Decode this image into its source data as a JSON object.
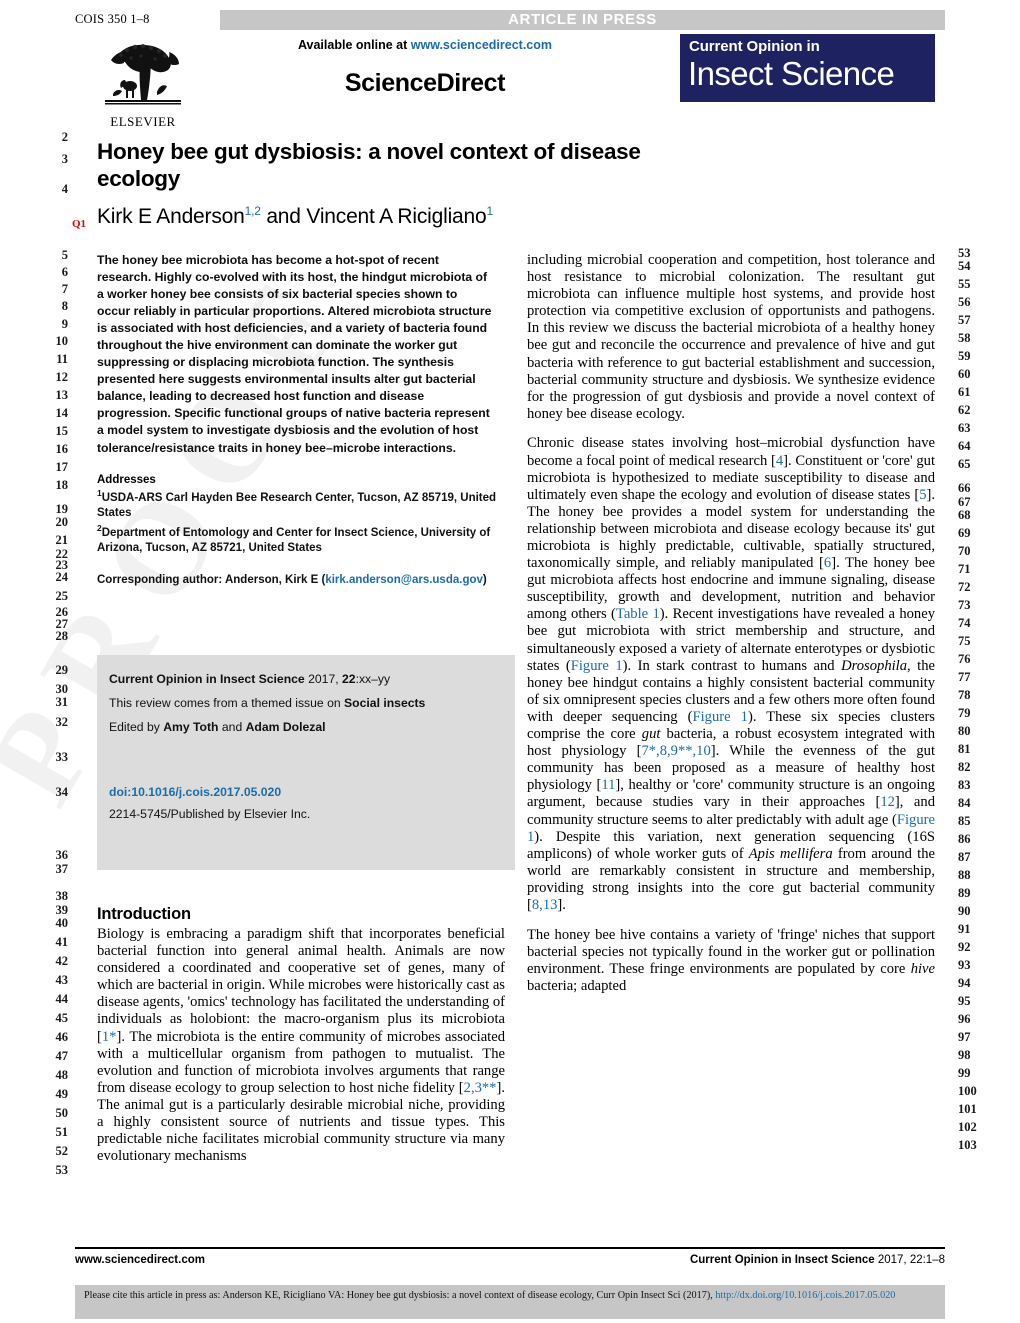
{
  "header": {
    "article_id": "COIS 350 1–8",
    "status_banner": "ARTICLE IN PRESS",
    "available_online": "Available online at",
    "sciencedirect_url": "www.sciencedirect.com",
    "sciencedirect_name": "ScienceDirect",
    "publisher_logo_text": "ELSEVIER",
    "journal_logo_line1": "Current Opinion in",
    "journal_logo_line2": "Insect Science",
    "colors": {
      "banner_gray": "#c6c6c6",
      "journal_navy": "#1f2260",
      "link_blue": "#1b6ca8",
      "query_red": "#e00000",
      "infobox_gray": "#dcdcdc"
    }
  },
  "article": {
    "title": "Honey bee gut dysbiosis: a novel context of disease ecology",
    "authors": "Kirk E Anderson and Vincent A Ricigliano",
    "author1_name": "Kirk E Anderson",
    "author1_sup": "1,2",
    "author2_name": "Vincent A Ricigliano",
    "author2_sup": "1",
    "query_marker": "Q1"
  },
  "abstract": {
    "text": "The honey bee microbiota has become a hot-spot of recent research. Highly co-evolved with its host, the hindgut microbiota of a worker honey bee consists of six bacterial species shown to occur reliably in particular proportions. Altered microbiota structure is associated with host deficiencies, and a variety of bacteria found throughout the hive environment can dominate the worker gut suppressing or displacing microbiota function. The synthesis presented here suggests environmental insults alter gut bacterial balance, leading to decreased host function and disease progression. Specific functional groups of native bacteria represent a model system to investigate dysbiosis and the evolution of host tolerance/resistance traits in honey bee–microbe interactions."
  },
  "addresses": {
    "heading": "Addresses",
    "items": [
      {
        "sup": "1",
        "text": "USDA-ARS Carl Hayden Bee Research Center, Tucson, AZ 85719, United States"
      },
      {
        "sup": "2",
        "text": "Department of Entomology and Center for Insect Science, University of Arizona, Tucson, AZ 85721, United States"
      }
    ],
    "corresponding_label": "Corresponding author: Anderson, Kirk E (",
    "corresponding_email": "kirk.anderson@ars.usda.gov",
    "corresponding_close": ")"
  },
  "infobox": {
    "journal_ref_bold": "Current Opinion in Insect Science",
    "journal_ref_rest": " 2017, ",
    "journal_volume": "22",
    "journal_pages": ":xx–yy",
    "themed_issue_pre": "This review comes from a themed issue on ",
    "themed_issue_topic": "Social insects",
    "edited_by_pre": "Edited by ",
    "editor1": "Amy Toth",
    "edited_by_mid": " and ",
    "editor2": "Adam Dolezal",
    "doi": "doi:10.1016/j.cois.2017.05.020",
    "issn_line": "2214-5745/Published by Elsevier Inc."
  },
  "introduction": {
    "heading": "Introduction",
    "paragraph1_a": "Biology is embracing a paradigm shift that incorporates beneficial bacterial function into general animal health. Animals are now considered a coordinated and cooperative set of genes, many of which are bacterial in origin. While microbes were historically cast as disease agents, 'omics' technology has facilitated the understanding of individuals as holobiont: the macro-organism plus its microbiota [",
    "ref1": "1*",
    "paragraph1_b": "]. The microbiota is the entire community of microbes associated with a multicellular organism from pathogen to mutualist. The evolution and function of microbiota involves arguments that range from disease ecology to group selection to host niche fidelity [",
    "ref2": "2,3**",
    "paragraph1_c": "]. The animal gut is a particularly desirable microbial niche, providing a highly consistent source of nutrients and tissue types. This predictable niche facilitates microbial community structure via many evolutionary mechanisms"
  },
  "right_column": {
    "para1_a": "including microbial cooperation and competition, host tolerance and host resistance to microbial colonization. The resultant gut microbiota can influence multiple host systems, and provide host protection via competitive exclusion of opportunists and pathogens. In this review we discuss the bacterial microbiota of a healthy honey bee gut and reconcile the occurrence and prevalence of hive and gut bacteria with reference to gut bacterial establishment and succession, bacterial community structure and dysbiosis. We synthesize evidence for the progression of gut dysbiosis and provide a novel context of honey bee disease ecology.",
    "para2_a": "Chronic disease states involving host–microbial dysfunction have become a focal point of medical research [",
    "ref4": "4",
    "para2_b": "]. Constituent or 'core' gut microbiota is hypothesized to mediate susceptibility to disease and ultimately even shape the ecology and evolution of disease states [",
    "ref5": "5",
    "para2_c": "]. The honey bee provides a model system for understanding the relationship between microbiota and disease ecology because its' gut microbiota is highly predictable, cultivable, spatially structured, taxonomically simple, and reliably manipulated [",
    "ref6": "6",
    "para2_d": "]. The honey bee gut microbiota affects host endocrine and immune signaling, disease susceptibility, growth and development, nutrition and behavior among others (",
    "ref_table1": "Table 1",
    "para2_e": "). Recent investigations have revealed a honey bee gut microbiota with strict membership and structure, and simultaneously exposed a variety of alternate enterotypes or dysbiotic states (",
    "ref_fig1_a": "Figure 1",
    "para2_f": "). In stark contrast to humans and ",
    "ital_drosophila": "Drosophila",
    "para2_g": ", the honey bee hindgut contains a highly consistent bacterial community of six omnipresent species clusters and a few others more often found with deeper sequencing (",
    "ref_fig1_b": "Figure 1",
    "para2_h": "). These six species clusters comprise the core ",
    "ital_gut": "gut",
    "para2_i": " bacteria, a robust ecosystem integrated with host physiology [",
    "ref7": "7*,8,9**,10",
    "para2_j": "]. While the evenness of the gut community has been proposed as a measure of healthy host physiology [",
    "ref11": "11",
    "para2_k": "], healthy or 'core' community structure is an ongoing argument, because studies vary in their approaches [",
    "ref12": "12",
    "para2_l": "], and community structure seems to alter predictably with adult age (",
    "ref_fig1_c": "Figure 1",
    "para2_m": "). Despite this variation, next generation sequencing (16S amplicons) of whole worker guts of ",
    "ital_apis": "Apis mellifera",
    "para2_n": " from around the world are remarkably consistent in structure and membership, providing strong insights into the core gut bacterial community [",
    "ref8_13": "8,13",
    "para2_o": "].",
    "para3": "The honey bee hive contains a variety of 'fringe' niches that support bacterial species not typically found in the worker gut or pollination environment. These fringe environments are populated by core ",
    "ital_hive": "hive",
    "para3_b": " bacteria; adapted"
  },
  "footer": {
    "left": "www.sciencedirect.com",
    "right_bold": "Current Opinion in Insect Science",
    "right_rest": " 2017, 22:1–8",
    "citation_text": "Please cite this article in press as: Anderson  KE, Ricigliano  VA: Honey bee gut dysbiosis: a novel context of disease ecology, Curr Opin Insect Sci (2017), ",
    "citation_link": "http://dx.doi.org/10.1016/j.cois.2017.05.020"
  },
  "line_numbers": {
    "left": [
      "2",
      "3",
      "4",
      "5",
      "6",
      "7",
      "8",
      "9",
      "10",
      "11",
      "12",
      "13",
      "14",
      "15",
      "16",
      "17",
      "18",
      "19",
      "20",
      "21",
      "22",
      "23",
      "24",
      "25",
      "26",
      "27",
      "28",
      "29",
      "30",
      "31",
      "32",
      "33",
      "34",
      "36",
      "37",
      "38",
      "39",
      "40",
      "41",
      "42",
      "43",
      "44",
      "45",
      "46",
      "47",
      "48",
      "49",
      "50",
      "51",
      "52",
      "53"
    ],
    "right": [
      "53",
      "54",
      "55",
      "56",
      "57",
      "58",
      "59",
      "60",
      "61",
      "62",
      "63",
      "64",
      "65",
      "66",
      "67",
      "68",
      "69",
      "70",
      "71",
      "72",
      "73",
      "74",
      "75",
      "76",
      "77",
      "78",
      "79",
      "80",
      "81",
      "82",
      "83",
      "84",
      "85",
      "86",
      "87",
      "88",
      "89",
      "90",
      "91",
      "92",
      "93",
      "94",
      "95",
      "96",
      "97",
      "98",
      "99",
      "100",
      "101",
      "102",
      "103"
    ]
  },
  "watermark": "PROOF"
}
